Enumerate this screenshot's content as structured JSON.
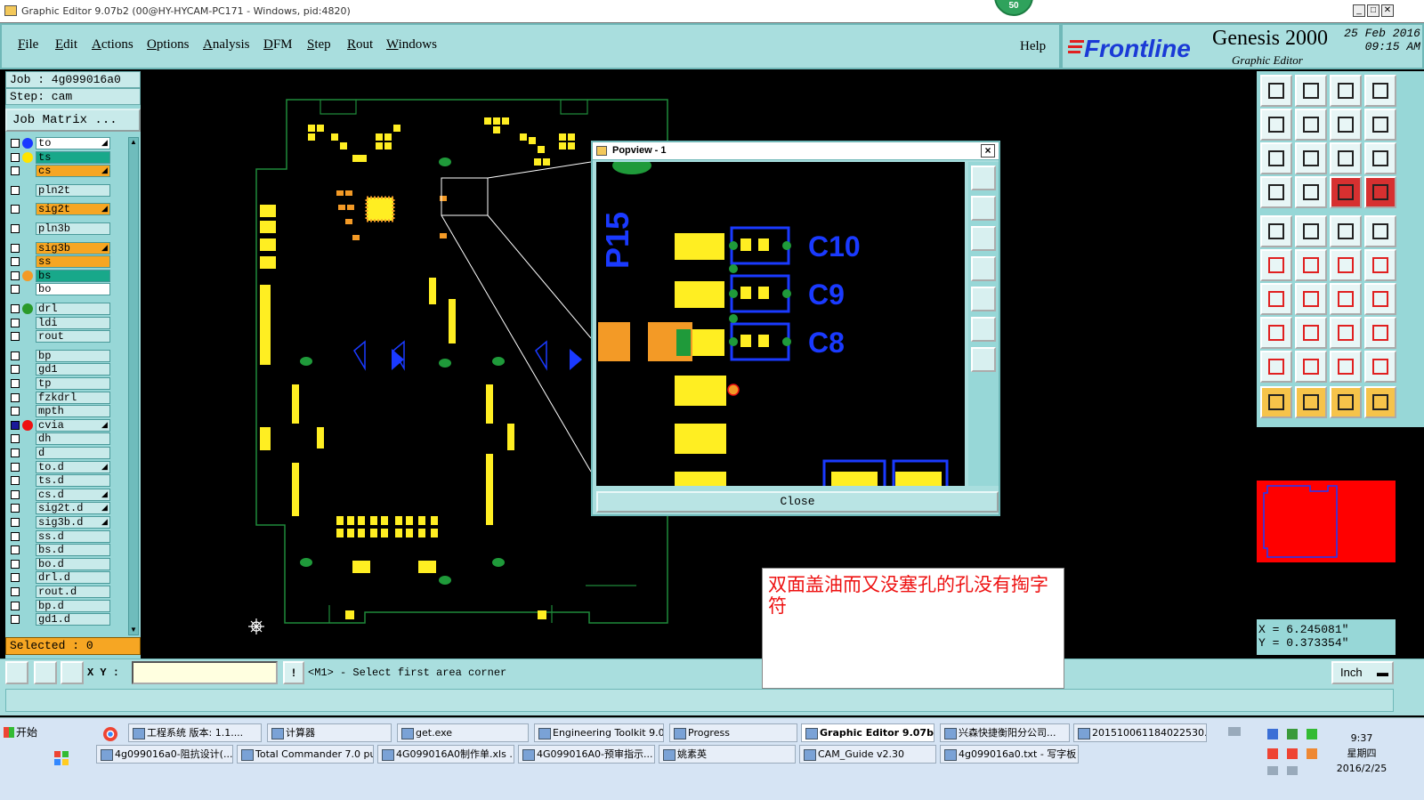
{
  "window": {
    "title": "Graphic Editor 9.07b2 (00@HY-HYCAM-PC171 - Windows, pid:4820)"
  },
  "badge": "50",
  "menu": [
    "File",
    "Edit",
    "Actions",
    "Options",
    "Analysis",
    "DFM",
    "Step",
    "Rout",
    "Windows"
  ],
  "help": "Help",
  "brand": {
    "logo": "Frontline",
    "name": "Genesis 2000",
    "sub": "Graphic Editor",
    "date": "25 Feb 2016",
    "time": "09:15 AM"
  },
  "job": {
    "job": "Job : 4g099016a0",
    "step": "Step: cam",
    "matrix": "Job Matrix ..."
  },
  "layers": [
    {
      "name": "to",
      "color": "#ffffff",
      "dot": "#1a3aff",
      "checked": false,
      "mark": true
    },
    {
      "name": "ts",
      "color": "#18a88a",
      "dot": "#ffe400",
      "checked": false,
      "mark": false
    },
    {
      "name": "cs",
      "color": "#f6a623",
      "dot": "",
      "checked": false,
      "mark": true
    },
    {
      "name": "pln2t",
      "color": "#c8eaea",
      "dot": "",
      "checked": false,
      "mark": false
    },
    {
      "name": "sig2t",
      "color": "#f6a623",
      "dot": "",
      "checked": false,
      "mark": true
    },
    {
      "name": "pln3b",
      "color": "#c8eaea",
      "dot": "",
      "checked": false,
      "mark": false
    },
    {
      "name": "sig3b",
      "color": "#f6a623",
      "dot": "",
      "checked": false,
      "mark": true
    },
    {
      "name": "ss",
      "color": "#f6a623",
      "dot": "",
      "checked": false,
      "mark": false
    },
    {
      "name": "bs",
      "color": "#18a88a",
      "dot": "#f39a26",
      "checked": false,
      "mark": false
    },
    {
      "name": "bo",
      "color": "#ffffff",
      "dot": "",
      "checked": false,
      "mark": false
    },
    {
      "name": "drl",
      "color": "#c8eaea",
      "dot": "#2a9a2a",
      "checked": false,
      "mark": false
    },
    {
      "name": "ldi",
      "color": "#c8eaea",
      "dot": "",
      "checked": false,
      "mark": false
    },
    {
      "name": "rout",
      "color": "#c8eaea",
      "dot": "",
      "checked": false,
      "mark": false
    },
    {
      "name": "bp",
      "color": "#c8eaea",
      "dot": "",
      "checked": false,
      "mark": false
    },
    {
      "name": "gd1",
      "color": "#c8eaea",
      "dot": "",
      "checked": false,
      "mark": false
    },
    {
      "name": "tp",
      "color": "#c8eaea",
      "dot": "",
      "checked": false,
      "mark": false
    },
    {
      "name": "fzkdrl",
      "color": "#c8eaea",
      "dot": "",
      "checked": false,
      "mark": false
    },
    {
      "name": "mpth",
      "color": "#c8eaea",
      "dot": "",
      "checked": false,
      "mark": false
    },
    {
      "name": "cvia",
      "color": "#c8eaea",
      "dot": "#ee1111",
      "checked": true,
      "mark": true
    },
    {
      "name": "dh",
      "color": "#c8eaea",
      "dot": "",
      "checked": false,
      "mark": false
    },
    {
      "name": "d",
      "color": "#c8eaea",
      "dot": "",
      "checked": false,
      "mark": false
    },
    {
      "name": "to.d",
      "color": "#c8eaea",
      "dot": "",
      "checked": false,
      "mark": true
    },
    {
      "name": "ts.d",
      "color": "#c8eaea",
      "dot": "",
      "checked": false,
      "mark": false
    },
    {
      "name": "cs.d",
      "color": "#c8eaea",
      "dot": "",
      "checked": false,
      "mark": true
    },
    {
      "name": "sig2t.d",
      "color": "#c8eaea",
      "dot": "",
      "checked": false,
      "mark": true
    },
    {
      "name": "sig3b.d",
      "color": "#c8eaea",
      "dot": "",
      "checked": false,
      "mark": true
    },
    {
      "name": "ss.d",
      "color": "#c8eaea",
      "dot": "",
      "checked": false,
      "mark": false
    },
    {
      "name": "bs.d",
      "color": "#c8eaea",
      "dot": "",
      "checked": false,
      "mark": false
    },
    {
      "name": "bo.d",
      "color": "#c8eaea",
      "dot": "",
      "checked": false,
      "mark": false
    },
    {
      "name": "drl.d",
      "color": "#c8eaea",
      "dot": "",
      "checked": false,
      "mark": false
    },
    {
      "name": "rout.d",
      "color": "#c8eaea",
      "dot": "",
      "checked": false,
      "mark": false
    },
    {
      "name": "bp.d",
      "color": "#c8eaea",
      "dot": "",
      "checked": false,
      "mark": false
    },
    {
      "name": "gd1.d",
      "color": "#c8eaea",
      "dot": "",
      "checked": false,
      "mark": false
    }
  ],
  "selected": "Selected : 0",
  "popview": {
    "title": "Popview - 1",
    "close": "Close",
    "labels": {
      "p15": "P15",
      "c10": "C10",
      "c9": "C9",
      "c8": "C8"
    }
  },
  "coords": {
    "x": "X = 6.245081\"",
    "y": "Y = 0.373354\""
  },
  "status": {
    "xy_label": "X Y :",
    "xy_value": "",
    "prompt": "<M1> - Select first area corner",
    "unit": "Inch"
  },
  "note": "双面盖油而又没塞孔的孔没有掏字符",
  "taskbar": {
    "start": "开始",
    "row1": [
      "工程系统  版本: 1.1....",
      "计算器",
      "get.exe",
      "Engineering Toolkit 9.0...",
      "Progress",
      "Graphic Editor 9.07b...",
      "兴森快捷衡阳分公司...",
      "201510061184022530.rt..."
    ],
    "row2": [
      "4g099016a0-阻抗设计(...",
      "Total Commander 7.0 pu...",
      "4G099016A0制作单.xls ...",
      "4G099016A0-预审指示...",
      "姚素英",
      "CAM_Guide v2.30",
      "4g099016a0.txt - 写字板"
    ],
    "active": "Graphic Editor 9.07b...",
    "clock": {
      "time": "9:37",
      "weekday": "星期四",
      "date": "2016/2/25"
    }
  },
  "colors": {
    "panel": "#a9dede",
    "accent": "#f6a623",
    "pad": "#ffee22",
    "outline": "#1a3aff"
  }
}
